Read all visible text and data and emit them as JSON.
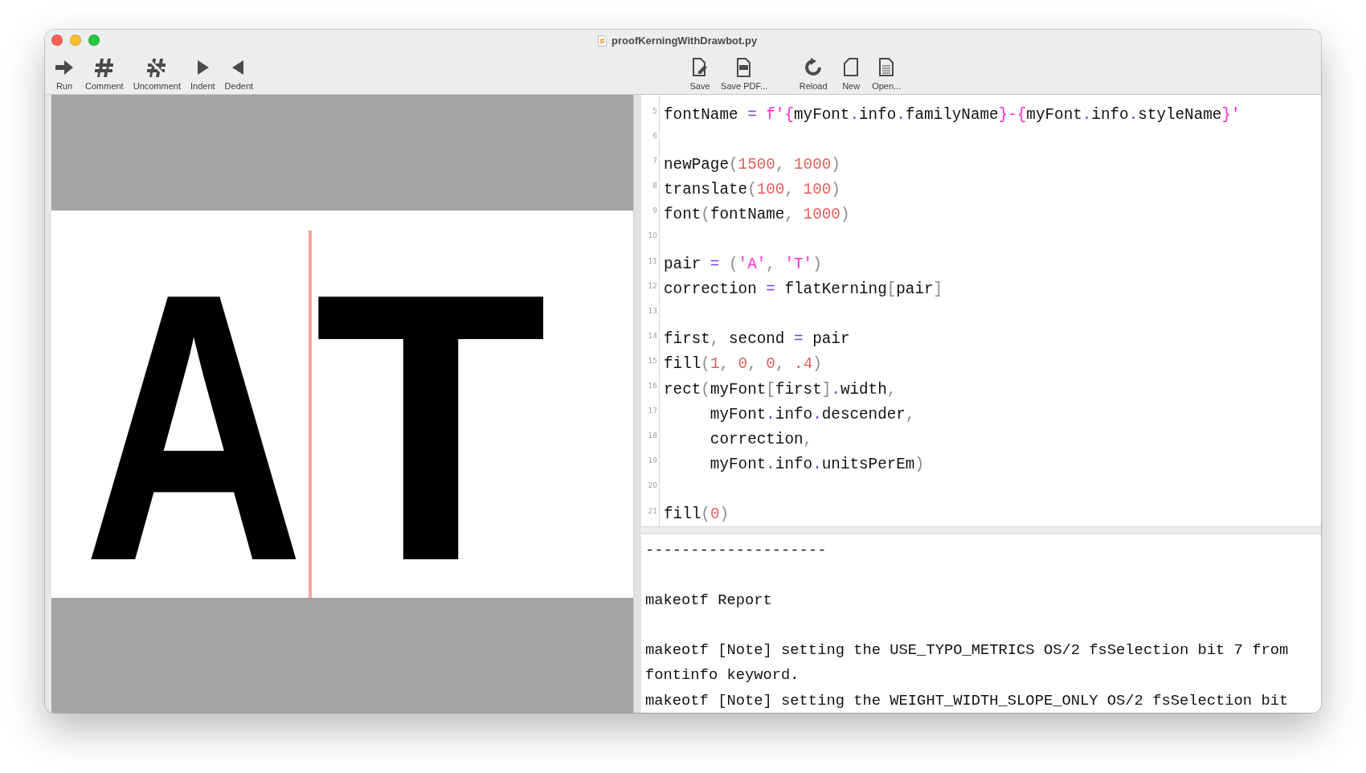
{
  "window": {
    "title": "proofKerningWithDrawbot.py"
  },
  "toolbar_left": [
    {
      "kind": "run",
      "label": "Run"
    },
    {
      "kind": "comment",
      "label": "Comment"
    },
    {
      "kind": "uncomment",
      "label": "Uncomment"
    },
    {
      "kind": "indent",
      "label": "Indent"
    },
    {
      "kind": "dedent",
      "label": "Dedent"
    }
  ],
  "toolbar_right": [
    {
      "kind": "save",
      "label": "Save"
    },
    {
      "kind": "savepdf",
      "label": "Save PDF..."
    },
    {
      "kind": "reload",
      "label": "Reload"
    },
    {
      "kind": "new",
      "label": "New"
    },
    {
      "kind": "open",
      "label": "Open..."
    }
  ],
  "preview": {
    "glyphs": [
      "A",
      "T"
    ]
  },
  "code": [
    {
      "number": "5",
      "tokens": [
        {
          "kind": "plain",
          "text": "fontName "
        },
        {
          "kind": "op",
          "text": "= "
        },
        {
          "kind": "str",
          "text": "f'{"
        },
        {
          "kind": "plain",
          "text": "myFont"
        },
        {
          "kind": "op",
          "text": "."
        },
        {
          "kind": "plain",
          "text": "info"
        },
        {
          "kind": "op",
          "text": "."
        },
        {
          "kind": "plain",
          "text": "familyName"
        },
        {
          "kind": "str",
          "text": "}-{"
        },
        {
          "kind": "plain",
          "text": "myFont"
        },
        {
          "kind": "op",
          "text": "."
        },
        {
          "kind": "plain",
          "text": "info"
        },
        {
          "kind": "op",
          "text": "."
        },
        {
          "kind": "plain",
          "text": "styleName"
        },
        {
          "kind": "str",
          "text": "}'"
        }
      ]
    },
    {
      "number": "6"
    },
    {
      "number": "7",
      "tokens": [
        {
          "kind": "plain",
          "text": "newPage"
        },
        {
          "kind": "punct",
          "text": "("
        },
        {
          "kind": "num",
          "text": "1500"
        },
        {
          "kind": "punct",
          "text": ", "
        },
        {
          "kind": "num",
          "text": "1000"
        },
        {
          "kind": "punct",
          "text": ")"
        }
      ]
    },
    {
      "number": "8",
      "tokens": [
        {
          "kind": "plain",
          "text": "translate"
        },
        {
          "kind": "punct",
          "text": "("
        },
        {
          "kind": "num",
          "text": "100"
        },
        {
          "kind": "punct",
          "text": ", "
        },
        {
          "kind": "num",
          "text": "100"
        },
        {
          "kind": "punct",
          "text": ")"
        }
      ]
    },
    {
      "number": "9",
      "tokens": [
        {
          "kind": "plain",
          "text": "font"
        },
        {
          "kind": "punct",
          "text": "("
        },
        {
          "kind": "plain",
          "text": "fontName"
        },
        {
          "kind": "punct",
          "text": ", "
        },
        {
          "kind": "num",
          "text": "1000"
        },
        {
          "kind": "punct",
          "text": ")"
        }
      ]
    },
    {
      "number": "10"
    },
    {
      "number": "11",
      "tokens": [
        {
          "kind": "plain",
          "text": "pair "
        },
        {
          "kind": "op",
          "text": "= "
        },
        {
          "kind": "punct",
          "text": "("
        },
        {
          "kind": "str",
          "text": "'A'"
        },
        {
          "kind": "punct",
          "text": ", "
        },
        {
          "kind": "str",
          "text": "'T'"
        },
        {
          "kind": "punct",
          "text": ")"
        }
      ]
    },
    {
      "number": "12",
      "tokens": [
        {
          "kind": "plain",
          "text": "correction "
        },
        {
          "kind": "op",
          "text": "= "
        },
        {
          "kind": "plain",
          "text": "flatKerning"
        },
        {
          "kind": "punct",
          "text": "["
        },
        {
          "kind": "plain",
          "text": "pair"
        },
        {
          "kind": "punct",
          "text": "]"
        }
      ]
    },
    {
      "number": "13"
    },
    {
      "number": "14",
      "tokens": [
        {
          "kind": "plain",
          "text": "first"
        },
        {
          "kind": "punct",
          "text": ", "
        },
        {
          "kind": "plain",
          "text": "second "
        },
        {
          "kind": "op",
          "text": "= "
        },
        {
          "kind": "plain",
          "text": "pair"
        }
      ]
    },
    {
      "number": "15",
      "tokens": [
        {
          "kind": "plain",
          "text": "fill"
        },
        {
          "kind": "punct",
          "text": "("
        },
        {
          "kind": "num",
          "text": "1"
        },
        {
          "kind": "punct",
          "text": ", "
        },
        {
          "kind": "num",
          "text": "0"
        },
        {
          "kind": "punct",
          "text": ", "
        },
        {
          "kind": "num",
          "text": "0"
        },
        {
          "kind": "punct",
          "text": ", "
        },
        {
          "kind": "num",
          "text": ".4"
        },
        {
          "kind": "punct",
          "text": ")"
        }
      ]
    },
    {
      "number": "16",
      "tokens": [
        {
          "kind": "plain",
          "text": "rect"
        },
        {
          "kind": "punct",
          "text": "("
        },
        {
          "kind": "plain",
          "text": "myFont"
        },
        {
          "kind": "punct",
          "text": "["
        },
        {
          "kind": "plain",
          "text": "first"
        },
        {
          "kind": "punct",
          "text": "]"
        },
        {
          "kind": "op",
          "text": "."
        },
        {
          "kind": "plain",
          "text": "width"
        },
        {
          "kind": "punct",
          "text": ","
        }
      ]
    },
    {
      "number": "17",
      "tokens": [
        {
          "kind": "plain",
          "text": "     myFont"
        },
        {
          "kind": "op",
          "text": "."
        },
        {
          "kind": "plain",
          "text": "info"
        },
        {
          "kind": "op",
          "text": "."
        },
        {
          "kind": "plain",
          "text": "descender"
        },
        {
          "kind": "punct",
          "text": ","
        }
      ]
    },
    {
      "number": "18",
      "tokens": [
        {
          "kind": "plain",
          "text": "     correction"
        },
        {
          "kind": "punct",
          "text": ","
        }
      ]
    },
    {
      "number": "19",
      "tokens": [
        {
          "kind": "plain",
          "text": "     myFont"
        },
        {
          "kind": "op",
          "text": "."
        },
        {
          "kind": "plain",
          "text": "info"
        },
        {
          "kind": "op",
          "text": "."
        },
        {
          "kind": "plain",
          "text": "unitsPerEm"
        },
        {
          "kind": "punct",
          "text": ")"
        }
      ]
    },
    {
      "number": "20"
    },
    {
      "number": "21",
      "tokens": [
        {
          "kind": "plain",
          "text": "fill"
        },
        {
          "kind": "punct",
          "text": "("
        },
        {
          "kind": "num",
          "text": "0"
        },
        {
          "kind": "punct",
          "text": ")"
        }
      ]
    }
  ],
  "output": [
    {
      "lines": [
        "--------------------"
      ]
    },
    {
      "lines": [
        "makeotf Report"
      ]
    },
    {
      "lines": [
        "makeotf [Note] setting the USE_TYPO_METRICS OS/2 fsSelection bit 7 from",
        "fontinfo keyword.",
        "makeotf [Note] setting the WEIGHT_WIDTH_SLOPE_ONLY OS/2 fsSelection bit"
      ]
    }
  ]
}
